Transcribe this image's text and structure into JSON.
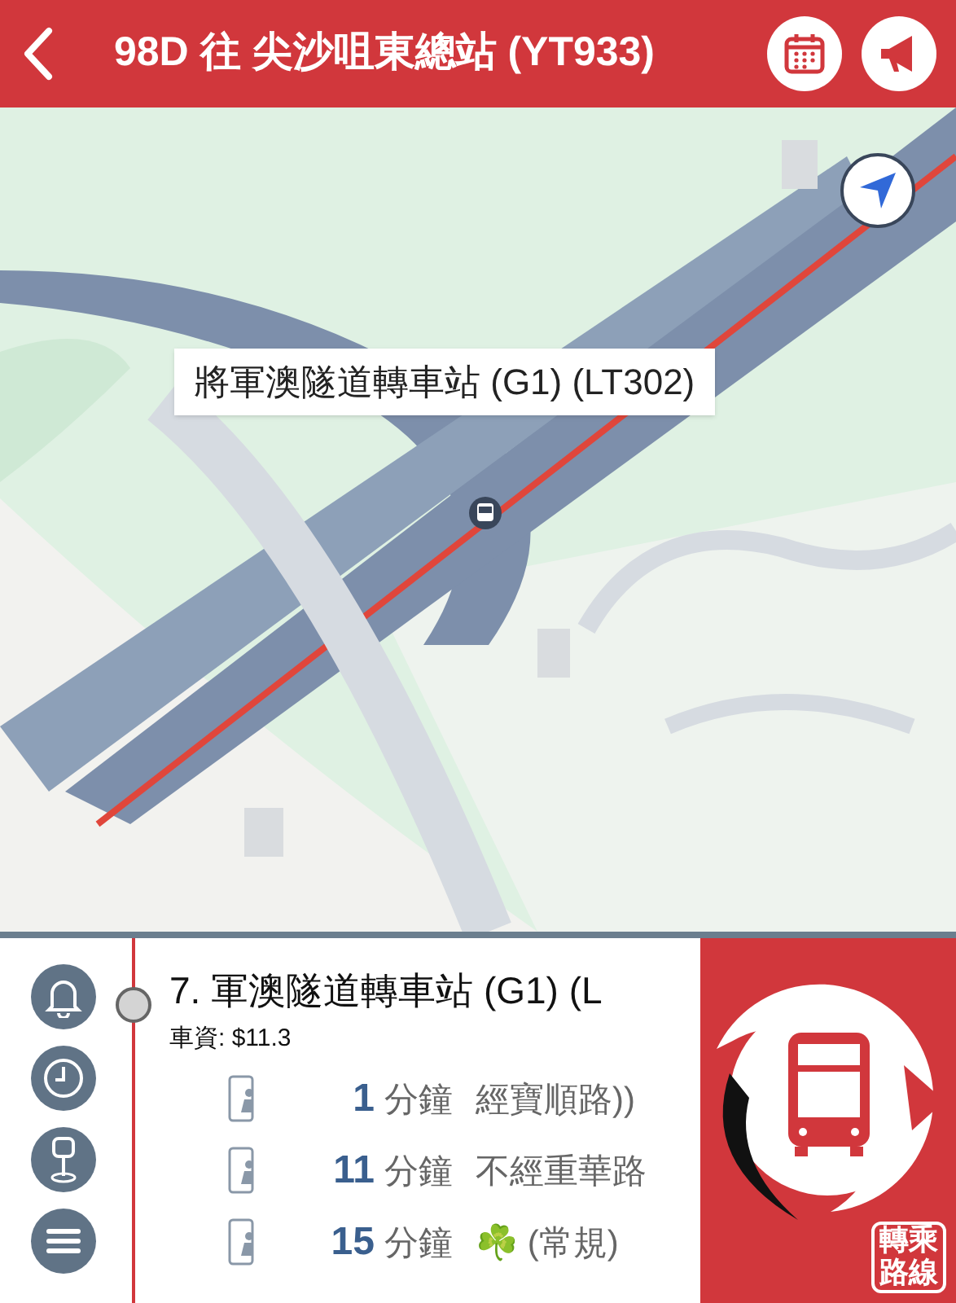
{
  "header": {
    "title": "98D 往 尖沙咀東總站 (YT933)"
  },
  "map": {
    "callout": "將軍澳隧道轉車站 (G1) (LT302)"
  },
  "stop": {
    "name": "7. 軍澳隧道轉車站 (G1) (L",
    "fare": "車資: $11.3",
    "etas": [
      {
        "minutes": "1",
        "unit": "分鐘",
        "remark": "經寶順路))"
      },
      {
        "minutes": "11",
        "unit": "分鐘",
        "remark": "不經重華路"
      },
      {
        "minutes": "15",
        "unit": "分鐘",
        "remark": "☘️ (常規)"
      }
    ]
  },
  "interchange_badge": "轉乘路線"
}
